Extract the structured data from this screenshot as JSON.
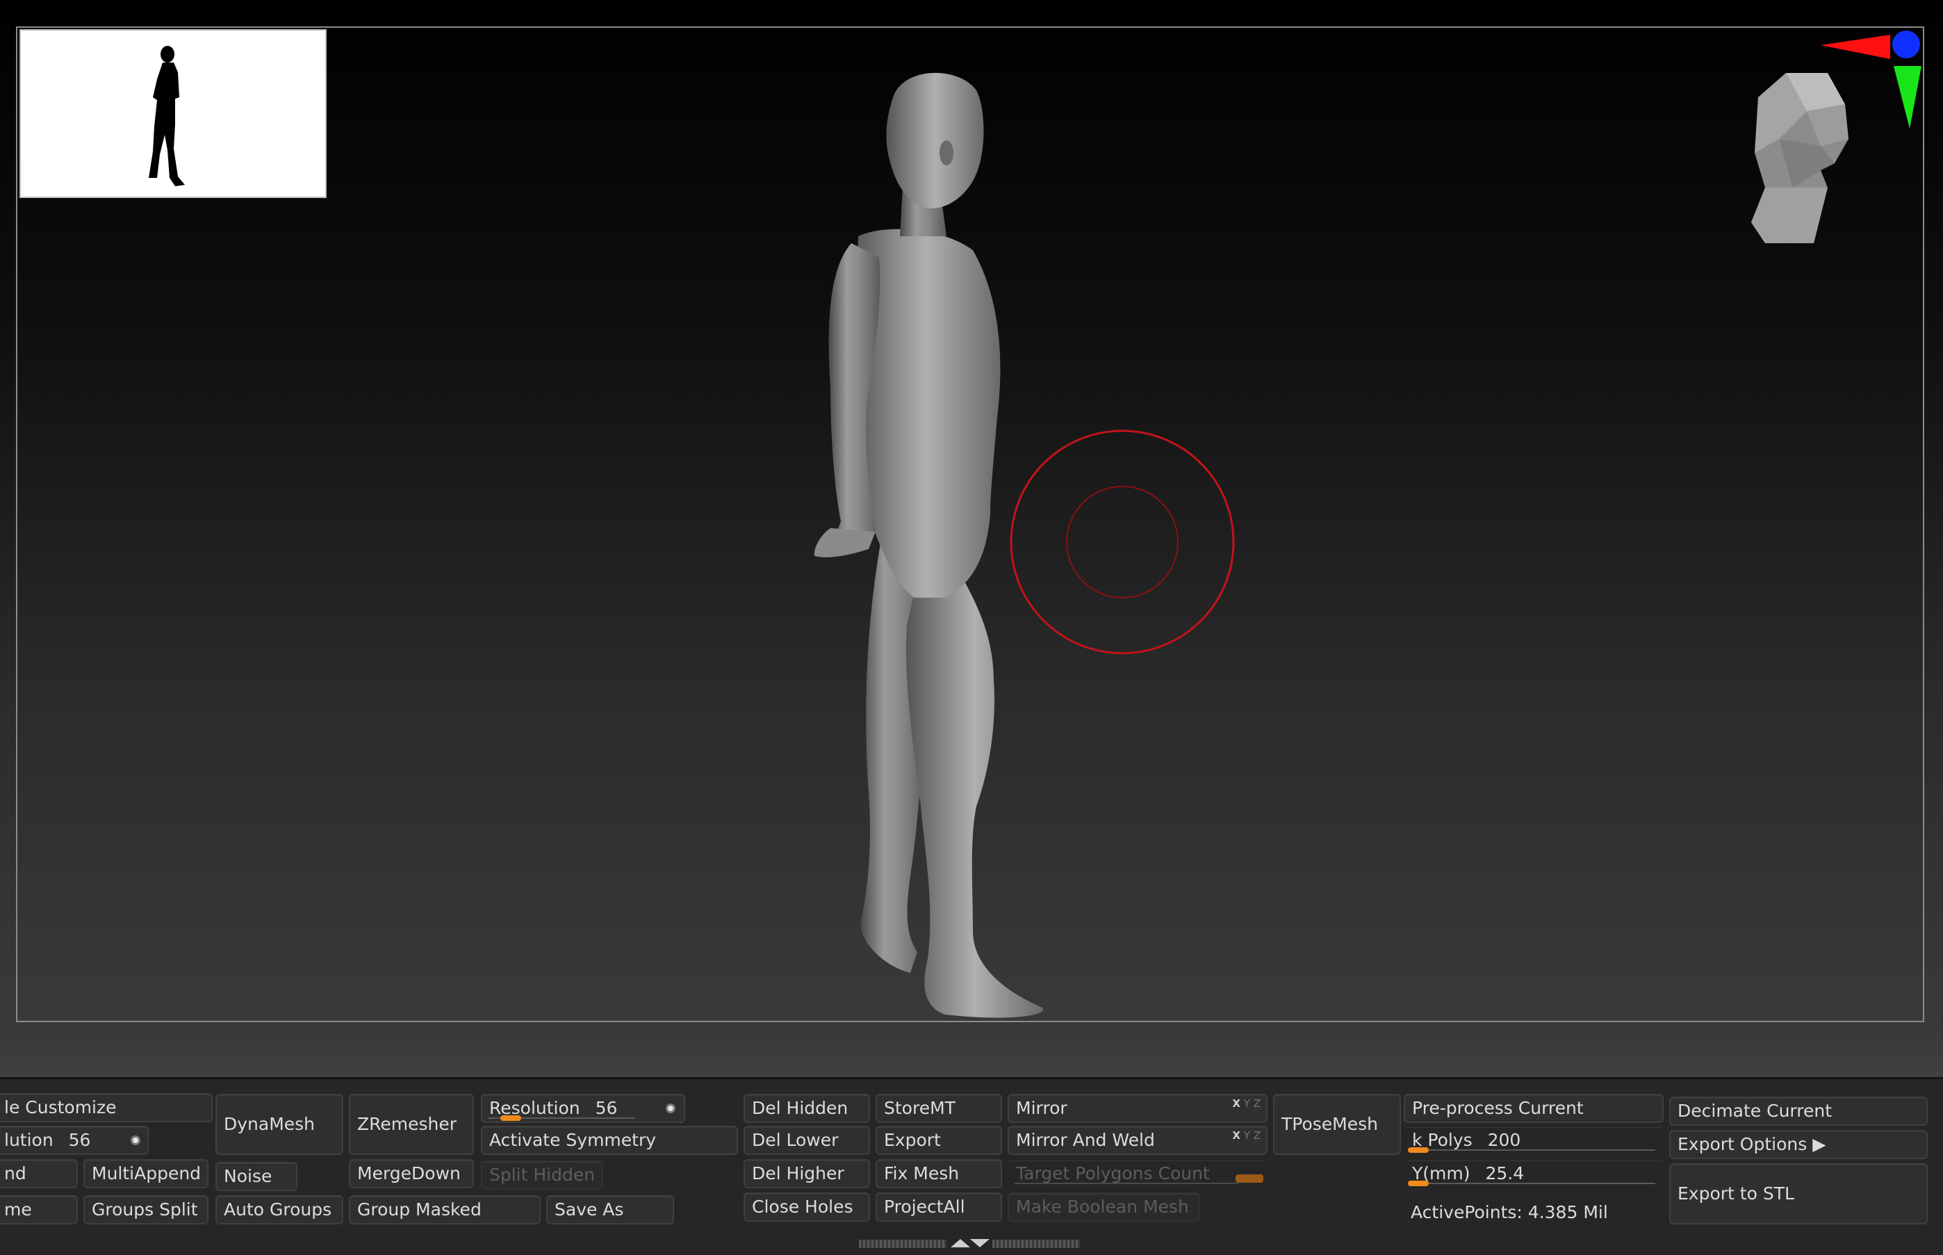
{
  "viewport": {
    "model_label": "Male figure sculpt, side view",
    "thumbnail_label": "Silhouette thumbnail"
  },
  "shelf": {
    "col1": {
      "customize": "le Customize",
      "resolution_label": "lution",
      "resolution_value": "56",
      "append": "nd",
      "name": "me"
    },
    "col2": {
      "multiappend": "MultiAppend",
      "groups_split": "Groups Split"
    },
    "col3": {
      "dynamesh": "DynaMesh",
      "noise": "Noise",
      "auto_groups": "Auto Groups"
    },
    "col4": {
      "zremesher": "ZRemesher",
      "mergedown": "MergeDown",
      "group_masked": "Group Masked"
    },
    "col5": {
      "resolution_label": "Resolution",
      "resolution_value": "56",
      "activate_symmetry": "Activate Symmetry",
      "split_hidden": "Split Hidden",
      "save_as": "Save As"
    },
    "col6": {
      "del_hidden": "Del Hidden",
      "del_lower": "Del Lower",
      "del_higher": "Del Higher",
      "close_holes": "Close Holes"
    },
    "col7": {
      "storemt": "StoreMT",
      "export": "Export",
      "fix_mesh": "Fix Mesh",
      "projectall": "ProjectAll"
    },
    "col8": {
      "mirror": "Mirror",
      "mirror_and_weld": "Mirror And Weld",
      "target_polygons_count": "Target Polygons Count",
      "make_boolean_mesh": "Make Boolean Mesh",
      "xyz": [
        "X",
        "Y",
        "Z"
      ]
    },
    "col9": {
      "tposemesh": "TPoseMesh"
    },
    "col10": {
      "preprocess_current": "Pre-process Current",
      "k_polys_label": "k Polys",
      "k_polys_value": "200",
      "ymm_label": "Y(mm)",
      "ymm_value": "25.4",
      "active_points": "ActivePoints: 4.385 Mil"
    },
    "col11": {
      "decimate_current": "Decimate Current",
      "export_options": "Export Options ▶",
      "export_to_stl": "Export to STL"
    }
  },
  "colors": {
    "accent_orange": "#f08a1c",
    "brush_ring": "#c0141a",
    "gizmo_x": "#ff1010",
    "gizmo_y": "#19e619",
    "gizmo_z": "#1030ff"
  },
  "icons": [
    "collapse-arrows-icon",
    "orientation-head-icon",
    "axis-gizmo-icon",
    "brush-cursor-icon"
  ]
}
